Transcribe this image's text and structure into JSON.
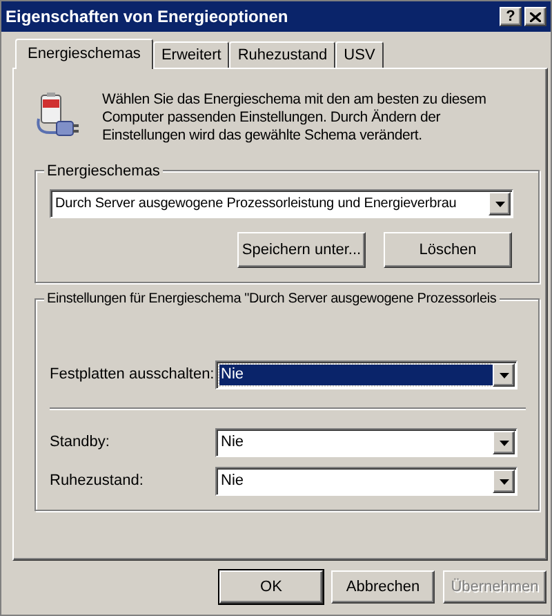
{
  "window": {
    "title": "Eigenschaften von Energieoptionen",
    "help": "?"
  },
  "tabs": [
    {
      "label": "Energieschemas",
      "selected": true
    },
    {
      "label": "Erweitert",
      "selected": false
    },
    {
      "label": "Ruhezustand",
      "selected": false
    },
    {
      "label": "USV",
      "selected": false
    }
  ],
  "description": "Wählen Sie das Energieschema mit den am besten zu diesem Computer passenden Einstellungen. Durch Ändern der Einstellungen wird das gewählte Schema verändert.",
  "schemes": {
    "label": "Energieschemas",
    "value": "Durch Server ausgewogene Prozessorleistung und Energieverbrau",
    "buttons": [
      "Speichern unter...",
      "Löschen"
    ]
  },
  "settings": {
    "label": "Einstellungen für Energieschema \"Durch Server ausgewogene Prozessorleis",
    "row_groups": [
      [
        {
          "label": "Festplatten ausschalten:",
          "value": "Nie",
          "selected": true
        }
      ],
      [
        {
          "label": "Standby:",
          "value": "Nie",
          "selected": false
        },
        {
          "label": "Ruhezustand:",
          "value": "Nie",
          "selected": false
        }
      ]
    ]
  },
  "buttons": [
    {
      "label": "OK",
      "disabled": false,
      "default": true
    },
    {
      "label": "Abbrechen",
      "disabled": false,
      "default": false
    },
    {
      "label": "Übernehmen",
      "disabled": true,
      "default": false
    }
  ]
}
